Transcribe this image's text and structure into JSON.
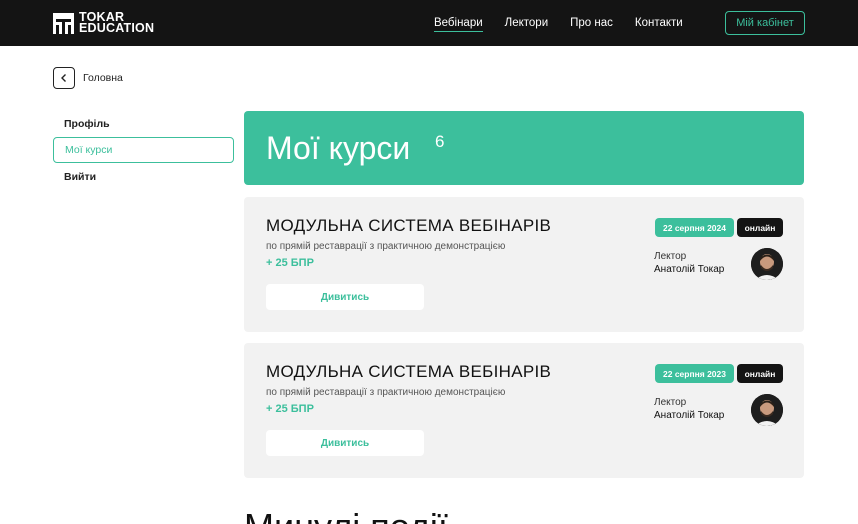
{
  "header": {
    "logo_line1": "TOKAR",
    "logo_line2": "EDUCATION",
    "nav": [
      "Вебінари",
      "Лектори",
      "Про нас",
      "Контакти"
    ],
    "cabinet_label": "Мій кабінет"
  },
  "breadcrumb": {
    "label": "Головна"
  },
  "sidebar": {
    "items": [
      "Профіль",
      "Мої курси",
      "Вийти"
    ]
  },
  "banner": {
    "title": "Мої курси",
    "count": "6"
  },
  "courses": [
    {
      "title": "МОДУЛЬНА СИСТЕМА ВЕБІНАРІВ",
      "subtitle": "по прямій реставрації з практичною демонстрацією",
      "bpr": "+ 25 БПР",
      "button": "Дивитись",
      "date": "22 серпня 2024",
      "format": "онлайн",
      "lector_label": "Лектор",
      "lector_name": "Анатолій Токар"
    },
    {
      "title": "МОДУЛЬНА СИСТЕМА ВЕБІНАРІВ",
      "subtitle": "по прямій реставрації з практичною демонстрацією",
      "bpr": "+ 25 БПР",
      "button": "Дивитись",
      "date": "22 серпня 2023",
      "format": "онлайн",
      "lector_label": "Лектор",
      "lector_name": "Анатолій Токар"
    }
  ],
  "past_events": {
    "title": "Минулі події"
  },
  "colors": {
    "accent": "#3cbf9c",
    "dark": "#141414",
    "card": "#f2f2f2"
  },
  "icons": {
    "back": "chevron-left-icon",
    "logo": "tokar-logo-icon",
    "avatar": "lector-avatar"
  }
}
